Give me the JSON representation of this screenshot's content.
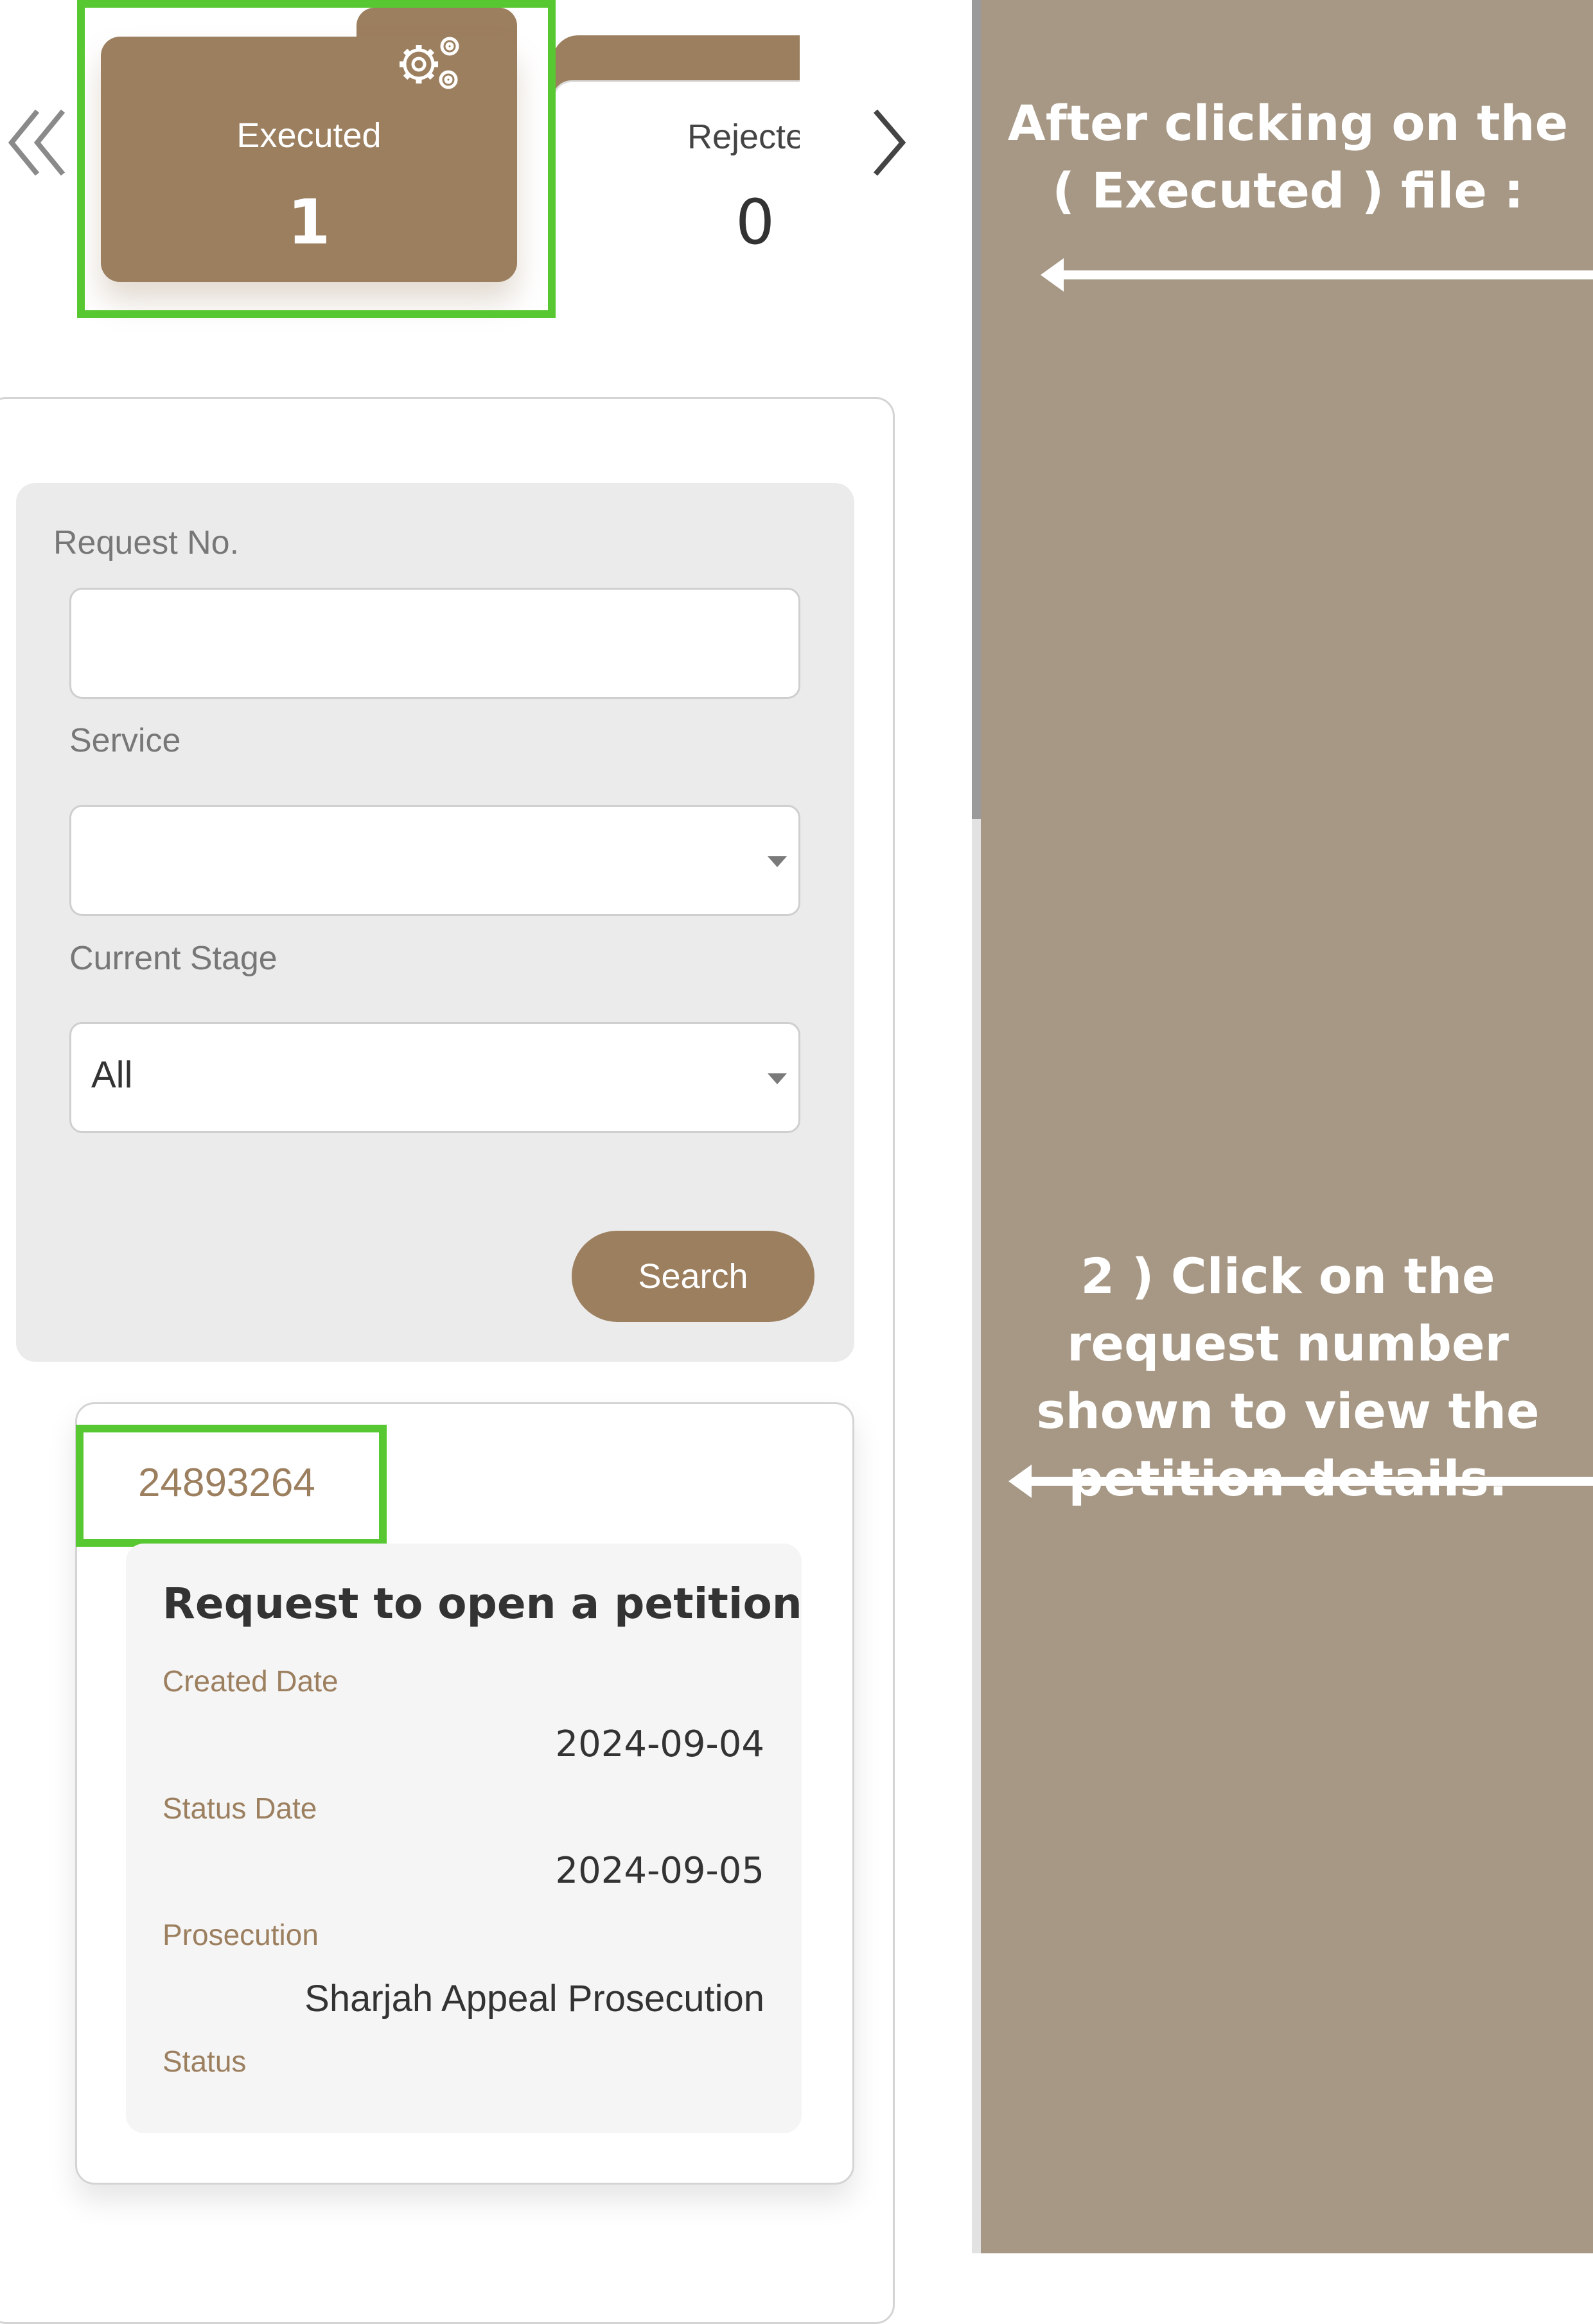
{
  "status_cards": [
    {
      "label": "Executed",
      "count": "1",
      "icon": "gears-icon"
    },
    {
      "label": "Rejecte",
      "count": "0"
    }
  ],
  "nav": {
    "prev_icon": "double-chevron-left-icon",
    "next_icon": "chevron-right-icon"
  },
  "search_form": {
    "request_no_label": "Request No.",
    "request_no_value": "",
    "service_label": "Service",
    "service_value": "",
    "stage_label": "Current Stage",
    "stage_value": "All",
    "search_button": "Search"
  },
  "result": {
    "request_number": "24893264",
    "service_title": "Request to open a petition",
    "created_date_label": "Created Date",
    "created_date": "2024-09-04",
    "status_date_label": "Status Date",
    "status_date": "2024-09-05",
    "prosecution_label": "Prosecution",
    "prosecution": "Sharjah Appeal Prosecution",
    "status_label": "Status"
  },
  "instructions": {
    "step1": "After clicking on the ( Executed ) file :",
    "step2": "2 ) Click on the request number shown to view the petition details."
  },
  "colors": {
    "brand": "#9c7f5f",
    "highlight": "#57c832",
    "instruction_bg": "#a79885"
  }
}
